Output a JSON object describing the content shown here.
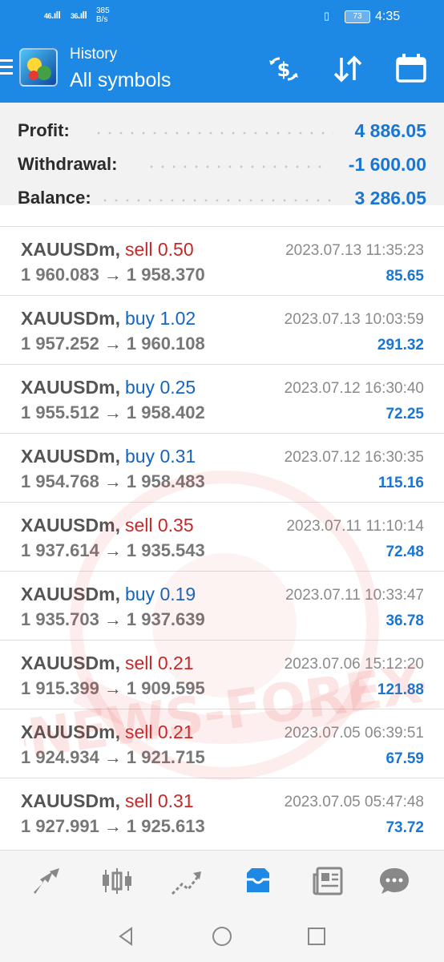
{
  "status_bar": {
    "sim1": "46",
    "sim2": "36",
    "net_speed_value": "385",
    "net_speed_unit": "B/s",
    "battery": "73",
    "time": "4:35"
  },
  "app_bar": {
    "subtitle": "History",
    "title": "All symbols",
    "icons": [
      "currency-sort-icon",
      "sort-arrows-icon",
      "calendar-icon"
    ]
  },
  "summary": {
    "profit": {
      "label": "Profit:",
      "value": "4 886.05"
    },
    "withdrawal": {
      "label": "Withdrawal:",
      "value": "-1 600.00"
    },
    "balance": {
      "label": "Balance:",
      "value": "3 286.05"
    }
  },
  "deals": [
    {
      "symbol": "XAUUSDm,",
      "type": "sell",
      "volume": "0.50",
      "side": "sell",
      "open": "1 960.083",
      "arrow": "→",
      "close": "1 958.370",
      "time": "2023.07.13 11:35:23",
      "profit": "85.65"
    },
    {
      "symbol": "XAUUSDm,",
      "type": "buy",
      "volume": "1.02",
      "side": "buy",
      "open": "1 957.252",
      "arrow": "→",
      "close": "1 960.108",
      "time": "2023.07.13 10:03:59",
      "profit": "291.32"
    },
    {
      "symbol": "XAUUSDm,",
      "type": "buy",
      "volume": "0.25",
      "side": "buy",
      "open": "1 955.512",
      "arrow": "→",
      "close": "1 958.402",
      "time": "2023.07.12 16:30:40",
      "profit": "72.25"
    },
    {
      "symbol": "XAUUSDm,",
      "type": "buy",
      "volume": "0.31",
      "side": "buy",
      "open": "1 954.768",
      "arrow": "→",
      "close": "1 958.483",
      "time": "2023.07.12 16:30:35",
      "profit": "115.16"
    },
    {
      "symbol": "XAUUSDm,",
      "type": "sell",
      "volume": "0.35",
      "side": "sell",
      "open": "1 937.614",
      "arrow": "→",
      "close": "1 935.543",
      "time": "2023.07.11 11:10:14",
      "profit": "72.48"
    },
    {
      "symbol": "XAUUSDm,",
      "type": "buy",
      "volume": "0.19",
      "side": "buy",
      "open": "1 935.703",
      "arrow": "→",
      "close": "1 937.639",
      "time": "2023.07.11 10:33:47",
      "profit": "36.78"
    },
    {
      "symbol": "XAUUSDm,",
      "type": "sell",
      "volume": "0.21",
      "side": "sell",
      "open": "1 915.399",
      "arrow": "→",
      "close": "1 909.595",
      "time": "2023.07.06 15:12:20",
      "profit": "121.88"
    },
    {
      "symbol": "XAUUSDm,",
      "type": "sell",
      "volume": "0.21",
      "side": "sell",
      "open": "1 924.934",
      "arrow": "→",
      "close": "1 921.715",
      "time": "2023.07.05 06:39:51",
      "profit": "67.59"
    },
    {
      "symbol": "XAUUSDm,",
      "type": "sell",
      "volume": "0.31",
      "side": "sell",
      "open": "1 927.991",
      "arrow": "→",
      "close": "1 925.613",
      "time": "2023.07.05 05:47:48",
      "profit": "73.72"
    }
  ],
  "bottom_nav": {
    "items": [
      "quotes-icon",
      "chart-icon",
      "trade-icon",
      "history-icon",
      "news-icon",
      "messages-icon"
    ],
    "active": "history-icon"
  },
  "watermark": {
    "text": "-NEWS-FOREX-"
  },
  "colors": {
    "primary": "#1e88e5",
    "profit_blue": "#1976d2",
    "sell_red": "#c62828",
    "buy_blue": "#1565c0",
    "watermark_red": "#e53935"
  },
  "system_nav": [
    "back-icon",
    "home-icon",
    "recents-icon"
  ]
}
